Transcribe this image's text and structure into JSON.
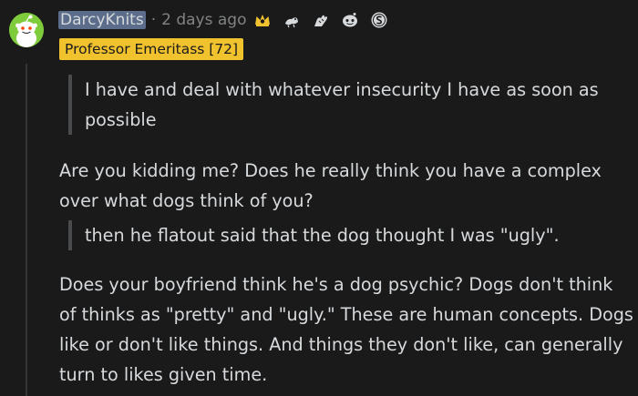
{
  "comment": {
    "author": "DarcyKnits",
    "separator": "·",
    "time": "2 days ago",
    "flair": "Professor Emeritass [72]",
    "awards": [
      "crown-award-icon",
      "animal-award-icon",
      "hands-award-icon",
      "snoo-award-icon",
      "coin-award-icon"
    ],
    "quote1": [
      "I have and deal with whatever insecurity I have as soon as",
      "possible"
    ],
    "para1": [
      "Are you kidding me? Does he really think you have a complex",
      "over what dogs think of you?"
    ],
    "quote2": [
      "then he flatout said that the dog thought I was \"ugly\"."
    ],
    "para2": [
      "Does your boyfriend think he's a dog psychic? Dogs don't think",
      "of thinks as \"pretty\" and \"ugly.\" These are human concepts. Dogs",
      "like or don't like things. And things they don't like, can generally",
      "turn to likes given time."
    ]
  },
  "colors": {
    "background": "#1a1a1b",
    "text": "#d7dadc",
    "meta": "#818384",
    "flair_bg": "#f0c22e",
    "avatar_bg": "#7ecb3b",
    "username_highlight": "#5b6d8a"
  }
}
